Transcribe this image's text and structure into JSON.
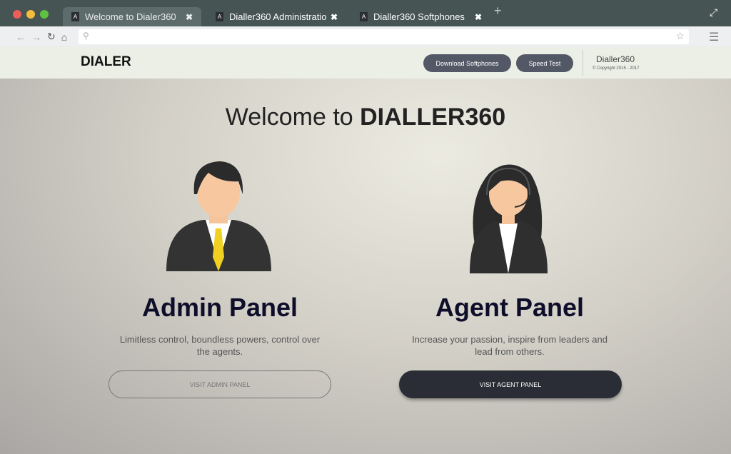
{
  "browser": {
    "tabs": [
      {
        "label": "Welcome to Dialer360",
        "active": true
      },
      {
        "label": "Dialler360 Administratio"
      },
      {
        "label": "Dialler360 Softphones"
      }
    ],
    "new_tab": "+",
    "url": ""
  },
  "header": {
    "logo": "DIALER",
    "download_label": "Download Softphones",
    "speed_label": "Speed Test",
    "brand": "Dialler360",
    "copyright": "© Copyright 2015 - 2017"
  },
  "main": {
    "welcome_prefix": "Welcome to ",
    "welcome_brand": "DIALLER360",
    "admin": {
      "title": "Admin Panel",
      "desc": "Limitless control, boundless powers, control over the agents.",
      "button": "VISIT ADMIN PANEL"
    },
    "agent": {
      "title": "Agent Panel",
      "desc": "Increase your passion, inspire from leaders and lead from others.",
      "button": "VISIT AGENT PANEL"
    }
  },
  "colors": {
    "tabbar": "#465453",
    "button_dark": "#2a2d35",
    "pill": "#535866"
  }
}
